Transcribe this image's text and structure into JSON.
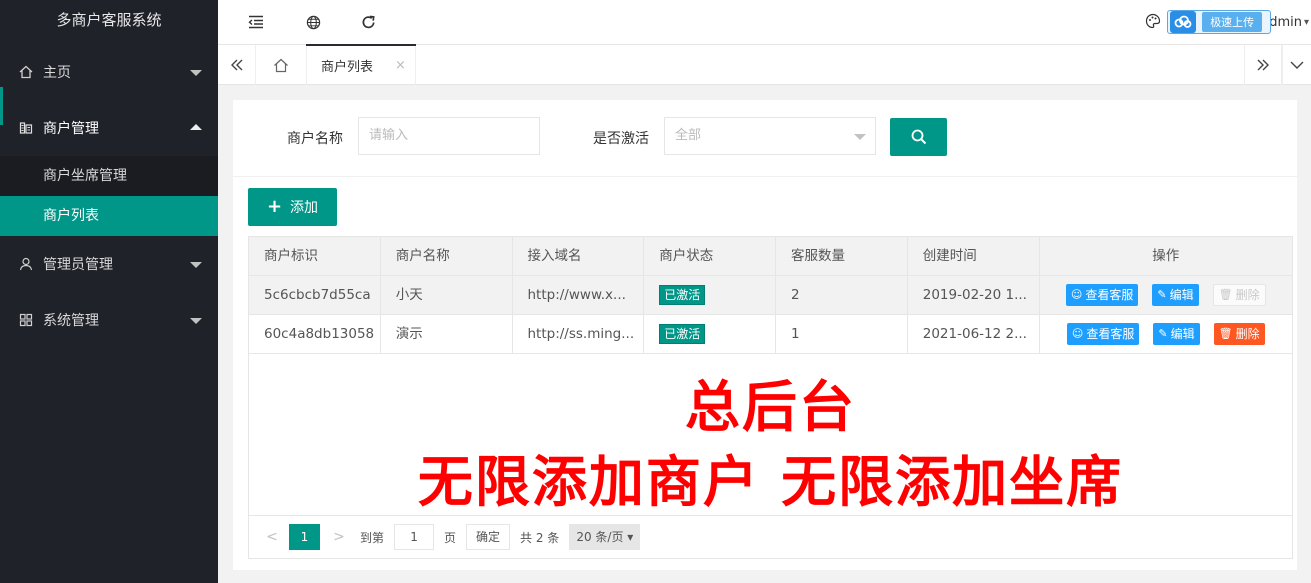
{
  "app": {
    "title": "多商户客服系统"
  },
  "sidebar": {
    "items": [
      {
        "label": "主页",
        "icon": "home-icon",
        "expanded": false
      },
      {
        "label": "商户管理",
        "icon": "merchant-icon",
        "expanded": true,
        "children": [
          {
            "label": "商户坐席管理"
          },
          {
            "label": "商户列表",
            "active": true
          }
        ]
      },
      {
        "label": "管理员管理",
        "icon": "user-icon",
        "expanded": false
      },
      {
        "label": "系统管理",
        "icon": "apps-icon",
        "expanded": false
      }
    ]
  },
  "header": {
    "upload_label": "极速上传",
    "user_label": "dmin"
  },
  "tabs": [
    {
      "label": "商户列表",
      "close": "×"
    }
  ],
  "filter": {
    "name_label": "商户名称",
    "name_placeholder": "请输入",
    "active_label": "是否激活",
    "active_value": "全部"
  },
  "toolbar": {
    "add_label": "添加"
  },
  "table": {
    "columns": [
      "商户标识",
      "商户名称",
      "接入域名",
      "商户状态",
      "客服数量",
      "创建时间",
      "操作"
    ],
    "rows": [
      {
        "id": "5c6cbcb7d55ca",
        "name": "小天",
        "domain": "http://www.x...",
        "status": "已激活",
        "agents": "2",
        "created": "2019-02-20 1...",
        "view": "查看客服",
        "edit": "编辑",
        "delete": "删除",
        "delete_enabled": false
      },
      {
        "id": "60c4a8db13058",
        "name": "演示",
        "domain": "http://ss.ming...",
        "status": "已激活",
        "agents": "1",
        "created": "2021-06-12 2...",
        "view": "查看客服",
        "edit": "编辑",
        "delete": "删除",
        "delete_enabled": true
      }
    ]
  },
  "overlay": {
    "line1": "总后台",
    "line2": "无限添加商户  无限添加坐席"
  },
  "pagination": {
    "prev": "<",
    "current": "1",
    "next": ">",
    "goto_label": "到第",
    "goto_value": "1",
    "page_unit": "页",
    "confirm": "确定",
    "total": "共 2 条",
    "page_size": "20 条/页"
  },
  "colors": {
    "accent": "#009688",
    "sidebar_bg": "#20222a",
    "blue": "#1e9fff",
    "danger": "#ff5722",
    "overlay_text": "#ff0000"
  }
}
